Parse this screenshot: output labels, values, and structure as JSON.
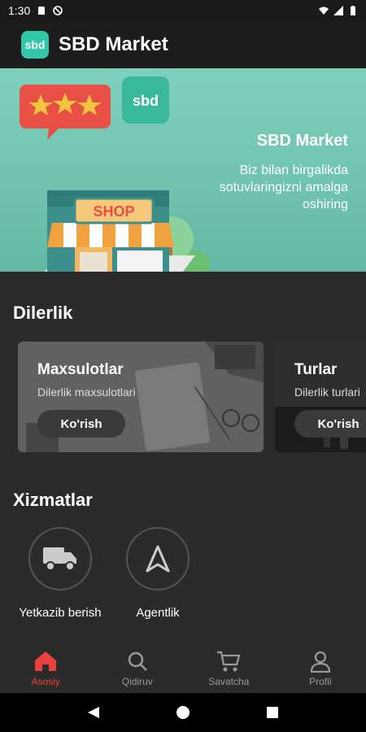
{
  "status": {
    "time": "1:30"
  },
  "app": {
    "title": "SBD Market",
    "logo_text": "sbd"
  },
  "banner": {
    "title": "SBD Market",
    "subtitle": "Biz bilan birgalikda sotuvlaringizni amalga oshiring",
    "logo_text": "sbd",
    "shop_text": "SHOP"
  },
  "dilerlik": {
    "heading": "Dilerlik",
    "cards": [
      {
        "title": "Maxsulotlar",
        "subtitle": "Dilerlik maxsulotlari",
        "button": "Ko'rish"
      },
      {
        "title": "Turlar",
        "subtitle": "Dilerlik turlari",
        "button": "Ko'rish"
      }
    ]
  },
  "xizmatlar": {
    "heading": "Xizmatlar",
    "items": [
      {
        "label": "Yetkazib berish",
        "icon": "truck-icon"
      },
      {
        "label": "Agentlik",
        "icon": "navigation-arrow-icon"
      }
    ]
  },
  "nav": {
    "items": [
      {
        "label": "Asosiy",
        "icon": "home-icon"
      },
      {
        "label": "Qidiruv",
        "icon": "search-icon"
      },
      {
        "label": "Savatcha",
        "icon": "cart-icon"
      },
      {
        "label": "Profil",
        "icon": "profile-icon"
      }
    ],
    "active_color": "#e8433a"
  }
}
